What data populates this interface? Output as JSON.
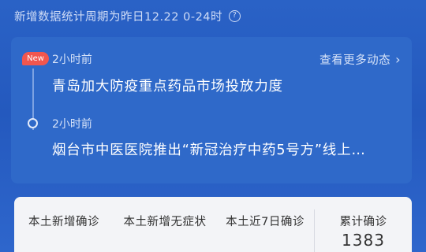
{
  "notice": {
    "text": "新增数据统计周期为昨日12.22 0-24时",
    "help_icon": "help-circle-icon"
  },
  "news": {
    "badge": "New",
    "more_label": "查看更多动态",
    "more_icon": "chevron-right-icon",
    "items": [
      {
        "time": "2小时前",
        "title": "青岛加大防疫重点药品市场投放力度"
      },
      {
        "time": "2小时前",
        "title": "烟台市中医医院推出“新冠治疗中药5号方”线上…"
      }
    ]
  },
  "stats": [
    {
      "label": "本土新增确诊",
      "value": ""
    },
    {
      "label": "本土新增无症状",
      "value": ""
    },
    {
      "label": "本土近7日确诊",
      "value": ""
    },
    {
      "label": "累计确诊",
      "value": "1383"
    }
  ],
  "colors": {
    "background": "#2a62c6",
    "card": "#2f69c9",
    "badge": "#f1564e",
    "panel": "#f3f4f7"
  }
}
